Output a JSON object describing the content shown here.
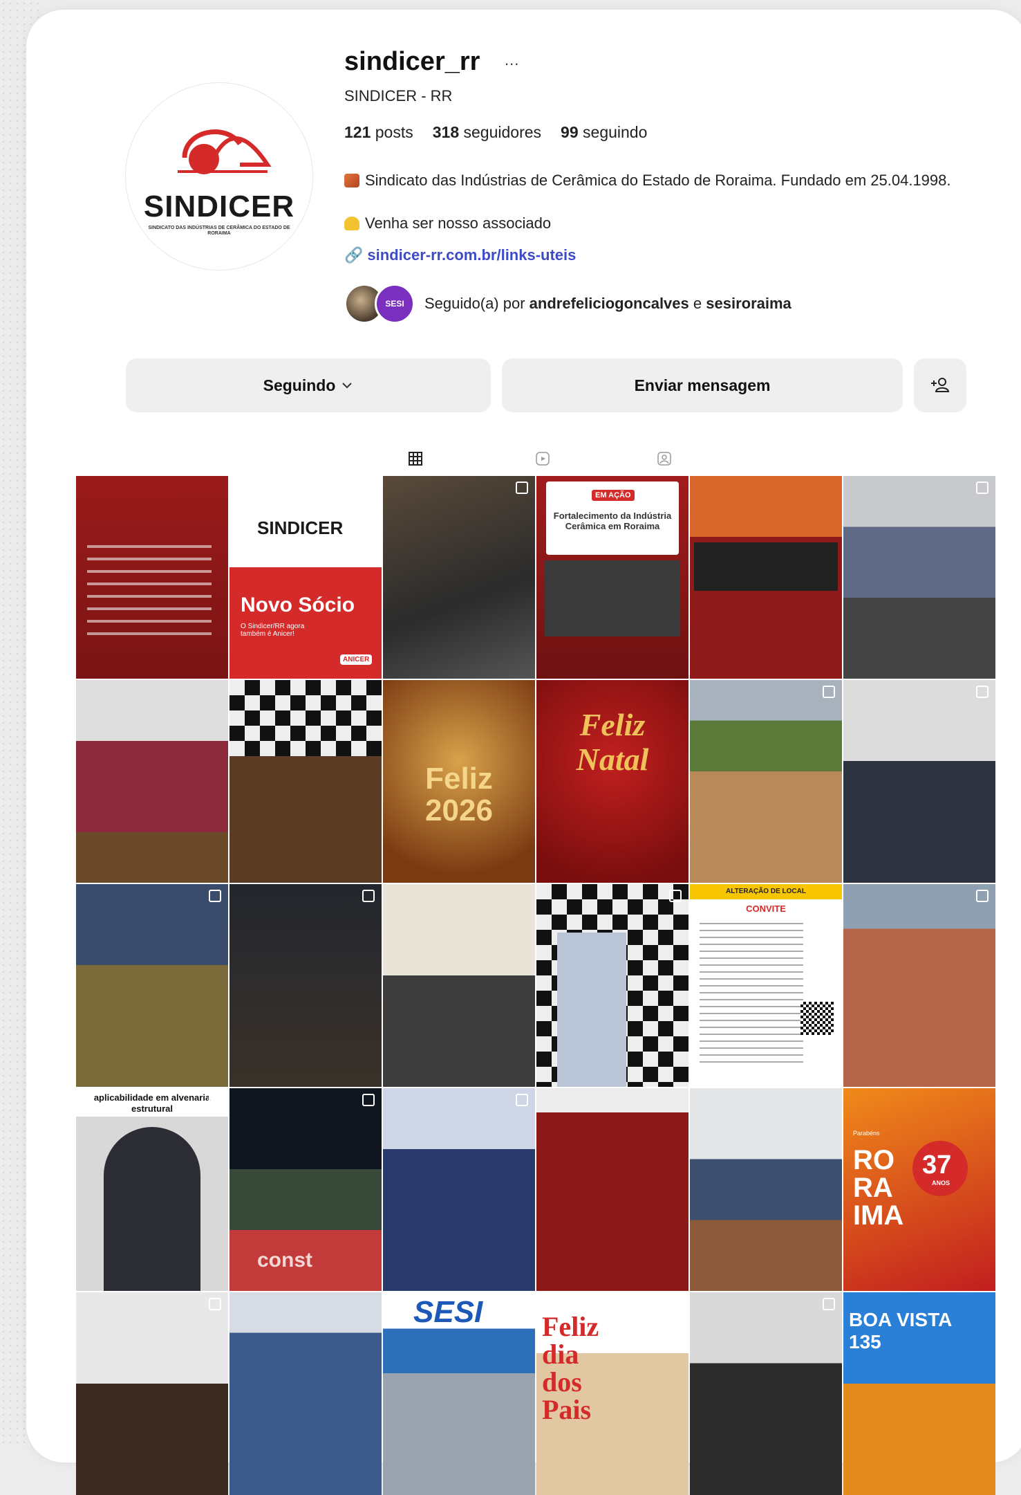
{
  "profile": {
    "username": "sindicer_rr",
    "more_icon": "...",
    "full_name": "SINDICER - RR",
    "logo_text": "SINDICER",
    "logo_subtext": "SINDICATO DAS INDÚSTRIAS DE CERÂMICA DO ESTADO DE RORAIMA",
    "stats": {
      "posts_count": "121",
      "posts_label": "posts",
      "followers_count": "318",
      "followers_label": "seguidores",
      "following_count": "99",
      "following_label": "seguindo"
    },
    "bio_line1": "Sindicato das Indústrias de Cerâmica do Estado de Roraima. Fundado em 25.04.1998.",
    "bio_line2": "Venha ser nosso associado",
    "link": "sindicer-rr.com.br/links-uteis",
    "followed_prefix": "Seguido(a) por",
    "followed_user1": "andrefeliciogoncalves",
    "followed_joiner": "e",
    "followed_user2": "sesiroraima",
    "mini_avatar2_text": "SESI"
  },
  "buttons": {
    "following": "Seguindo",
    "message": "Enviar mensagem",
    "add_icon": "+person"
  },
  "tabs": [
    "grid-icon",
    "reels-icon",
    "tagged-icon"
  ],
  "grid_texts": {
    "post2_title": "Novo Sócio",
    "post2_sub": "O Sindicer/RR agora também é Anicer!",
    "post2_logo": "SINDICER",
    "post2_badge": "ANICER",
    "post4_badge": "EM AÇÃO",
    "post4_title": "Fortalecimento da Indústria Cerâmica em Roraima",
    "post9_text": "Feliz 2026",
    "post10_text": "Feliz Natal",
    "post17_header": "ALTERAÇÃO DE LOCAL",
    "post17_sub": "CONVITE",
    "post19_text": "aplicabilidade em alvenaria estrutural",
    "post20_text": "const",
    "post24_text1": "RO RA IMA",
    "post24_badge": "37",
    "post24_badge_sub": "ANOS",
    "post24_label": "Parabéns",
    "post27_text": "SESI",
    "post28_text": "Feliz dia dos Pais",
    "post30_text": "BOA VISTA 135"
  },
  "colors": {
    "link_blue": "#3d4bc7",
    "brand_red": "#d42a2a",
    "button_gray": "#efefef"
  }
}
